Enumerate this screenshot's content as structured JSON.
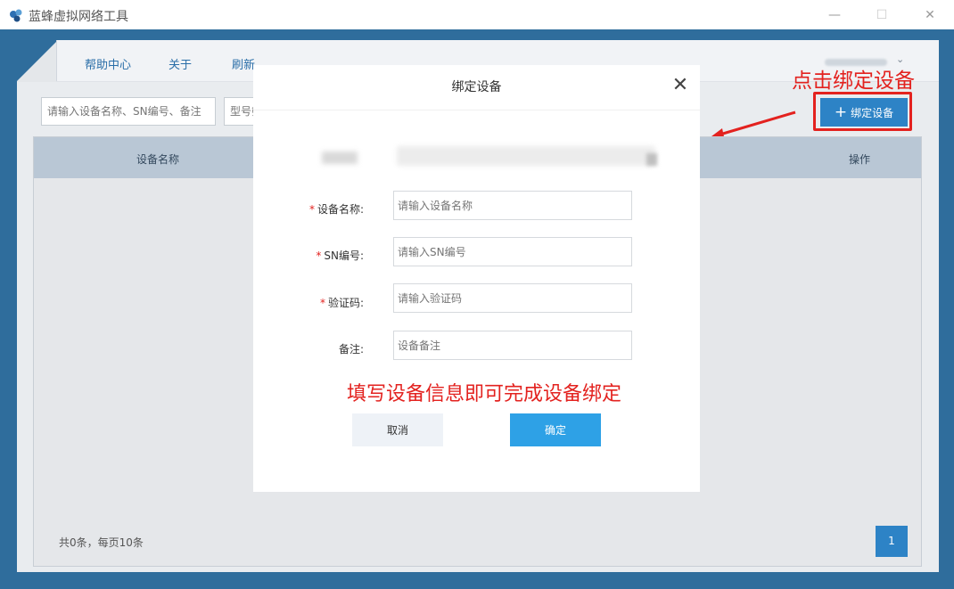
{
  "window": {
    "title": "蓝蜂虚拟网络工具",
    "minimize": "—",
    "maximize": "☐",
    "close": "✕"
  },
  "nav": {
    "items": [
      "帮助中心",
      "关于",
      "刷新"
    ],
    "user_caret": "⌄"
  },
  "toolbar": {
    "search_placeholder": "请输入设备名称、SN编号、备注",
    "model_placeholder": "型号筛选",
    "bind_button": "绑定设备",
    "bind_plus": "+"
  },
  "annotations": {
    "top_callout": "点击绑定设备",
    "form_hint": "填写设备信息即可完成设备绑定",
    "accent_color": "#e3221f"
  },
  "table": {
    "columns": [
      "设备名称",
      "操作"
    ],
    "rows": [],
    "footer": "共0条，每页10条",
    "current_page": "1"
  },
  "modal": {
    "title": "绑定设备",
    "close": "✕",
    "fields": [
      {
        "label": "设备名称:",
        "required": true,
        "placeholder": "请输入设备名称"
      },
      {
        "label": "SN编号:",
        "required": true,
        "placeholder": "请输入SN编号"
      },
      {
        "label": "验证码:",
        "required": true,
        "placeholder": "请输入验证码"
      },
      {
        "label": "备注:",
        "required": false,
        "placeholder": "设备备注"
      }
    ],
    "required_mark": "*",
    "cancel": "取消",
    "confirm": "确定"
  },
  "colors": {
    "frame_blue": "#2f6d9c",
    "primary_button": "#2d83c6",
    "confirm_button": "#2ea1e6"
  }
}
